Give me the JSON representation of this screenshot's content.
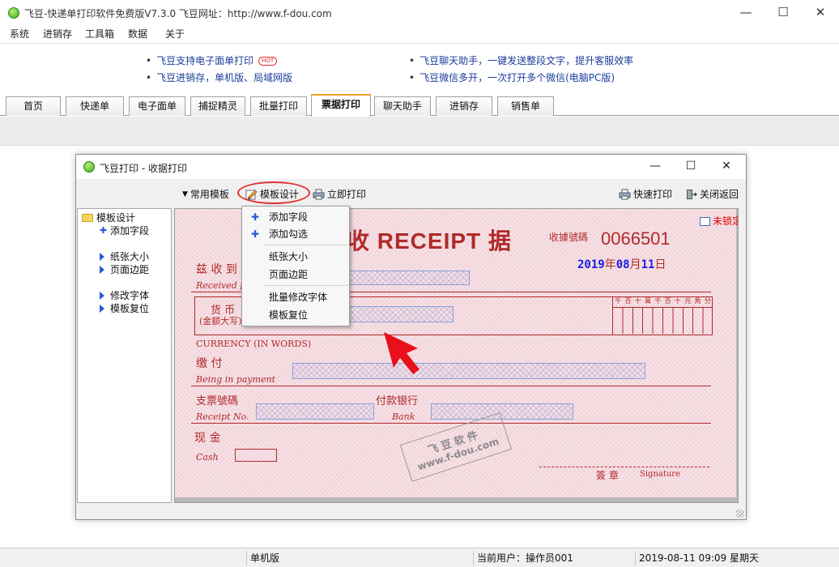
{
  "window": {
    "title": "飞豆-快递单打印软件免费版V7.3.0   飞豆网址：http://www.f-dou.com",
    "minimize_icon": "—",
    "maximize_icon": "☐",
    "close_icon": "✕"
  },
  "menu": [
    "系统",
    "进销存",
    "工具箱",
    "数据",
    "关于"
  ],
  "news": {
    "left": [
      "飞豆支持电子面单打印",
      "飞豆进销存，单机版、局域网版"
    ],
    "right": [
      "飞豆聊天助手，一键发送整段文字，提升客服效率",
      "飞豆微信多开，一次打开多个微信(电脑PC版)"
    ],
    "hot_badge": "HOT"
  },
  "tabs": [
    "首页",
    "快递单",
    "电子面单",
    "捕捉精灵",
    "批量打印",
    "票据打印",
    "聊天助手",
    "进销存",
    "销售单"
  ],
  "active_tab": "票据打印",
  "dialog": {
    "title": "飞豆打印 - 收据打印",
    "toolbar": {
      "common_templates": "常用模板",
      "template_design": "模板设计",
      "print_now": "立即打印",
      "quick_print": "快速打印",
      "close_return": "关闭返回"
    },
    "tree": {
      "root": "模板设计",
      "items": [
        "添加字段",
        "纸张大小",
        "页面边距",
        "修改字体",
        "模板复位"
      ]
    },
    "dropdown": [
      "添加字段",
      "添加勾选",
      "纸张大小",
      "页面边距",
      "批量修改字体",
      "模板复位"
    ],
    "lock_label": "未锁定"
  },
  "receipt": {
    "header": "收 RECEIPT 据",
    "number_label": "收據號碼",
    "number": "0066501",
    "date": {
      "year": "2019",
      "year_unit": "年",
      "month": "08",
      "month_unit": "月",
      "day": "11",
      "day_unit": "日"
    },
    "received_from_cn": "兹 收 到",
    "received_from_en": "Received from",
    "currency_cn": "货 币",
    "amount_cn": "(金额大写)",
    "currency_en": "CURRENCY (IN WORDS)",
    "payment_cn": "缴    付",
    "payment_en": "Being in payment",
    "cheque_cn": "支票號碼",
    "receipt_no_en": "Receipt No.",
    "bank_cn": "付款银行",
    "bank_en": "Bank",
    "cash_cn": "现  金",
    "cash_en": "Cash",
    "sign_cn": "簽  章",
    "sign_en": "Signature",
    "digits": [
      "千",
      "百",
      "十",
      "萬",
      "千",
      "百",
      "十",
      "元",
      "角",
      "分"
    ],
    "watermark_cn": "飞豆软件",
    "watermark_url": "www.f-dou.com"
  },
  "status": {
    "mode": "单机版",
    "user": "当前用户：操作员001",
    "datetime": "2019-08-11 09:09 星期天"
  }
}
